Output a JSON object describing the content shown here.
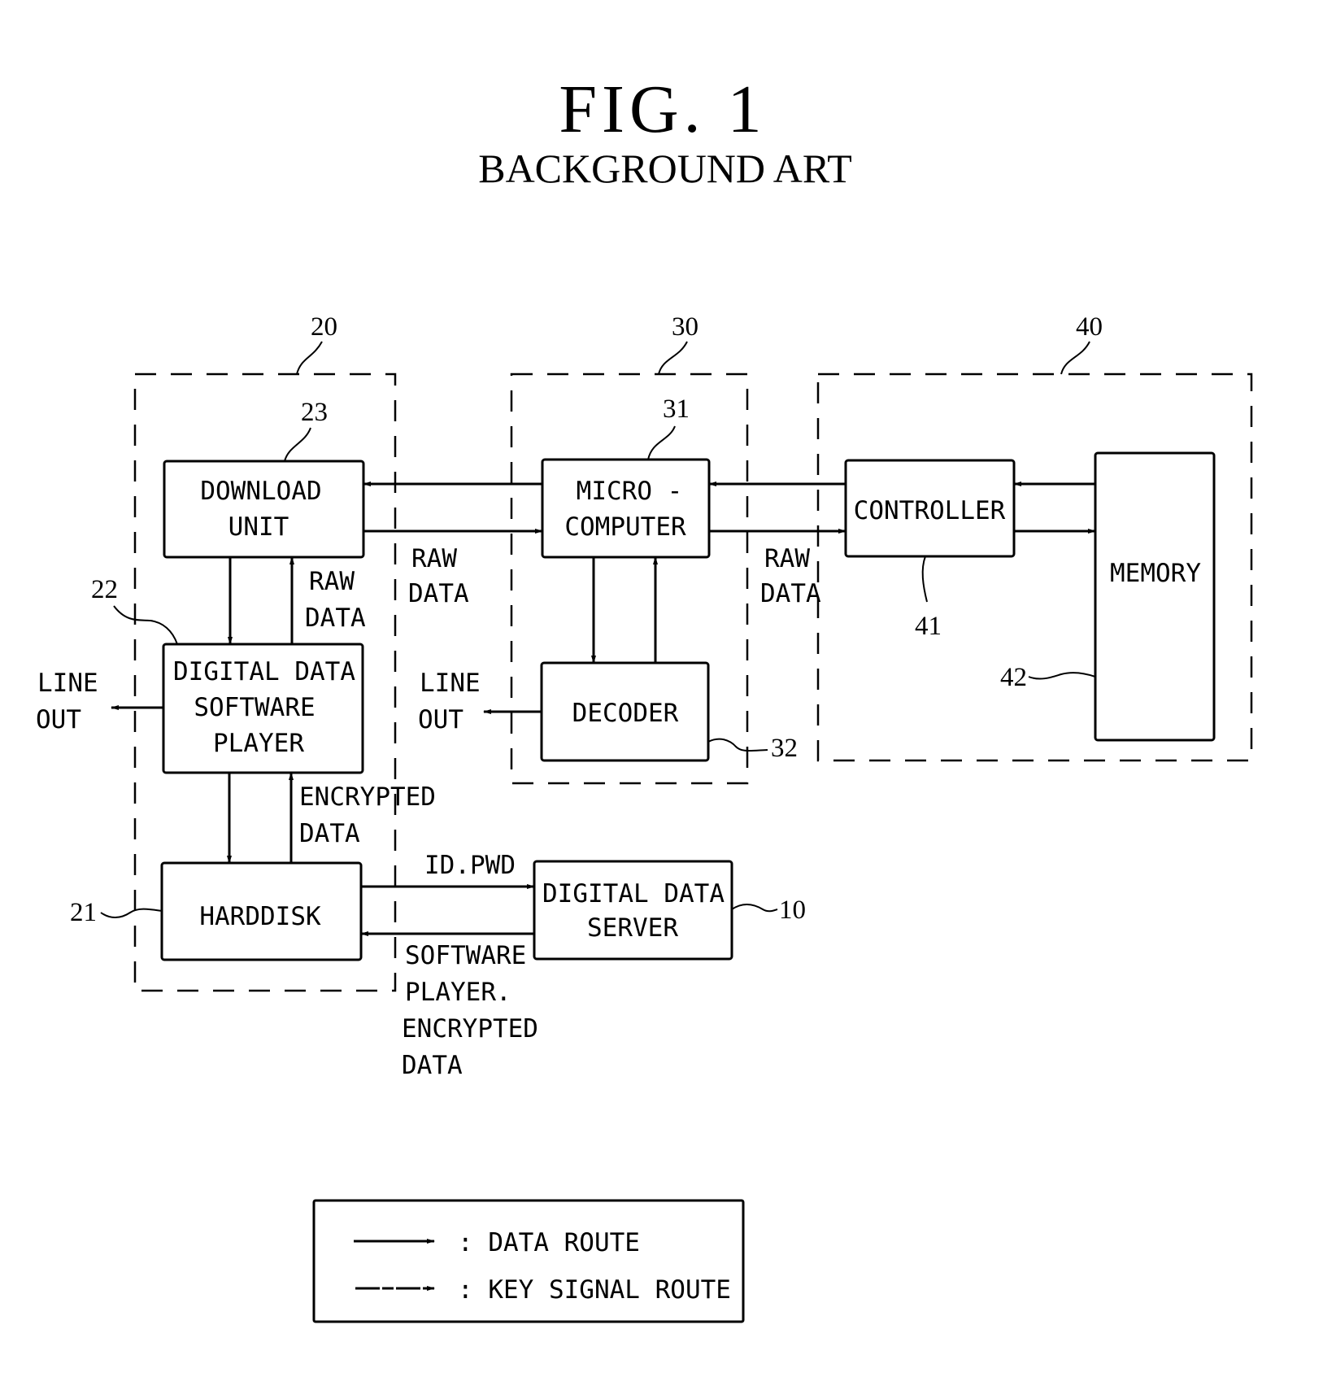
{
  "figure": {
    "title": "FIG.  1",
    "subtitle": "BACKGROUND ART"
  },
  "groups": [
    {
      "id": "20",
      "ref": "20"
    },
    {
      "id": "30",
      "ref": "30"
    },
    {
      "id": "40",
      "ref": "40"
    }
  ],
  "blocks": {
    "download_unit": {
      "ref": "23",
      "lines": [
        "DOWNLOAD",
        "UNIT"
      ]
    },
    "software_player": {
      "ref": "22",
      "lines": [
        "DIGITAL DATA",
        "SOFTWARE",
        "PLAYER"
      ]
    },
    "harddisk": {
      "ref": "21",
      "lines": [
        "HARDDISK"
      ]
    },
    "microcomputer": {
      "ref": "31",
      "lines": [
        "MICRO -",
        "COMPUTER"
      ]
    },
    "decoder": {
      "ref": "32",
      "lines": [
        "DECODER"
      ]
    },
    "controller": {
      "ref": "41",
      "lines": [
        "CONTROLLER"
      ]
    },
    "memory": {
      "ref": "42",
      "lines": [
        "MEMORY"
      ]
    },
    "server": {
      "ref": "10",
      "lines": [
        "DIGITAL DATA",
        "SERVER"
      ]
    }
  },
  "edge_labels": {
    "raw_data_player": [
      "RAW",
      "DATA"
    ],
    "raw_data_dl_micro": [
      "RAW",
      "DATA"
    ],
    "raw_data_micro_ctrl": [
      "RAW",
      "DATA"
    ],
    "encrypted_data": [
      "ENCRYPTED",
      "DATA"
    ],
    "id_pwd": "ID.PWD",
    "software_player_encrypted": [
      "SOFTWARE",
      "PLAYER.",
      "ENCRYPTED",
      "DATA"
    ],
    "line_out_player": [
      "LINE",
      "OUT"
    ],
    "line_out_decoder": [
      "LINE",
      "OUT"
    ]
  },
  "legend": {
    "items": [
      {
        "label": ":  DATA ROUTE",
        "style": "solid"
      },
      {
        "label": ":  KEY SIGNAL ROUTE",
        "style": "key"
      }
    ]
  }
}
